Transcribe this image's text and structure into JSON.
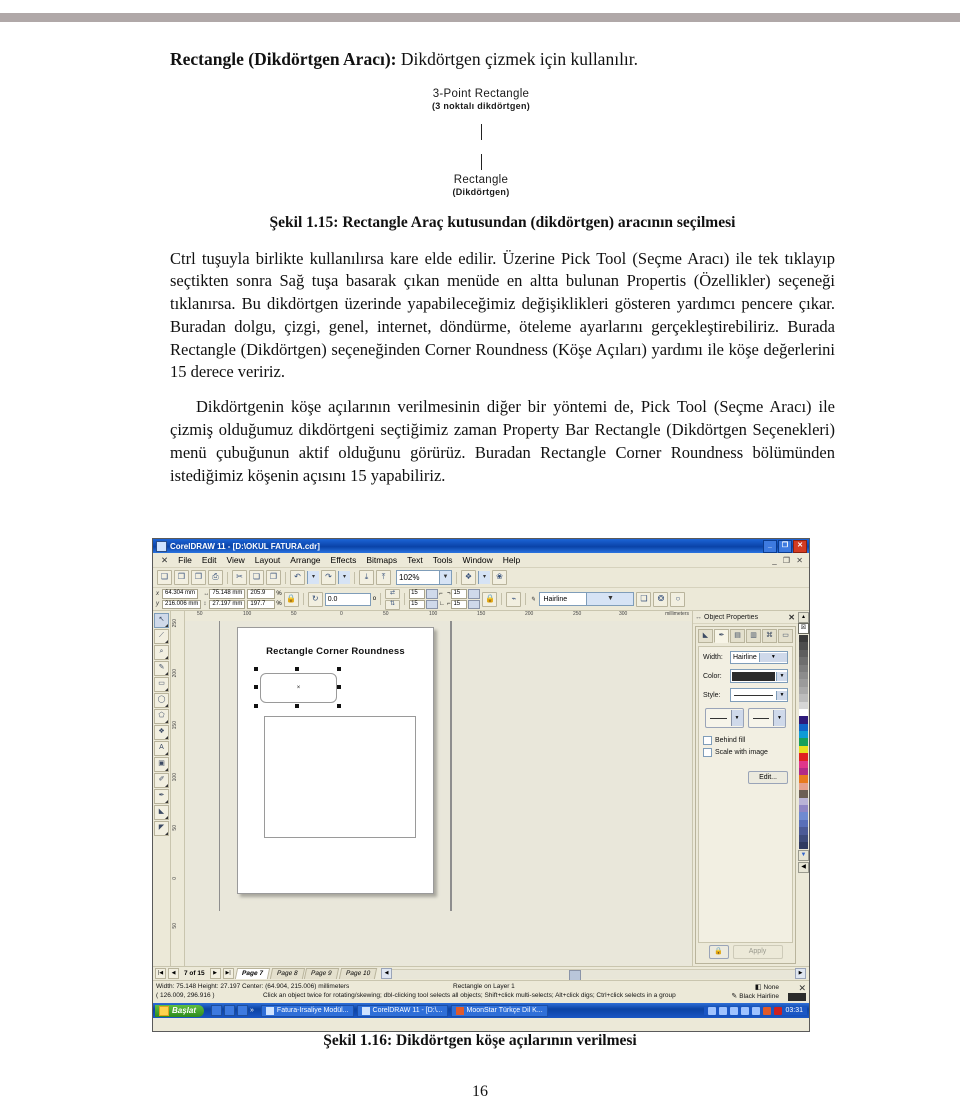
{
  "document": {
    "title_bold": "Rectangle (Dikdörtgen Aracı):",
    "title_rest": " Dikdörtgen çizmek için kullanılır.",
    "figure_1": {
      "label_top_l1": "3-Point Rectangle",
      "label_top_l2": "(3 noktalı dikdörtgen)",
      "label_bottom_l1": "Rectangle",
      "label_bottom_l2": "(Dikdörtgen)"
    },
    "caption_1": "Şekil 1.15: Rectangle Araç kutusundan (dikdörtgen) aracının seçilmesi",
    "paragraph_1": "Ctrl tuşuyla birlikte kullanılırsa kare elde edilir. Üzerine Pick Tool (Seçme Aracı) ile tek tıklayıp seçtikten sonra Sağ tuşa basarak çıkan menüde en altta bulunan Propertis (Özellikler) seçeneği tıklanırsa. Bu dikdörtgen üzerinde yapabileceğimiz değişiklikleri gösteren yardımcı pencere çıkar. Buradan dolgu, çizgi, genel, internet, döndürme, öteleme ayarlarını gerçekleştirebiliriz. Burada Rectangle (Dikdörtgen) seçeneğinden Corner Roundness (Köşe Açıları) yardımı ile köşe değerlerini 15 derece veririz.",
    "paragraph_2": "Dikdörtgenin köşe açılarının verilmesinin diğer bir yöntemi de, Pick Tool (Seçme Aracı) ile çizmiş olduğumuz dikdörtgeni seçtiğimiz zaman Property Bar Rectangle (Dikdörtgen Seçenekleri) menü çubuğunun aktif olduğunu görürüz. Buradan Rectangle Corner Roundness bölümünden istediğimiz köşenin açısını 15 yapabiliriz.",
    "caption_2": "Şekil 1.16: Dikdörtgen köşe açılarının verilmesi",
    "page_number": "16"
  },
  "app": {
    "titlebar": {
      "text": "CorelDRAW 11 - [D:\\OKUL FATURA.cdr]",
      "minimize": "_",
      "restore": "❐",
      "close": "✕"
    },
    "menu": {
      "doc_icon": "✕",
      "items": [
        "File",
        "Edit",
        "View",
        "Layout",
        "Arrange",
        "Effects",
        "Bitmaps",
        "Text",
        "Tools",
        "Window",
        "Help"
      ],
      "doc_buttons": "_ ❐ ✕"
    },
    "toolbar": {
      "buttons": [
        "new-document",
        "open-document",
        "save-document",
        "print-document",
        "cut",
        "copy",
        "paste",
        "undo",
        "redo",
        "import",
        "export"
      ],
      "zoom_value": "102%",
      "zoom_caret": "▼",
      "extra": [
        "application-launcher",
        "corel-online"
      ]
    },
    "property_bar": {
      "x_label": "x",
      "y_label": "y",
      "x_value": "64.304 mm",
      "y_value": "216.006 mm",
      "width_value": "75.148 mm",
      "height_value": "27.197 mm",
      "scale_h": "205.9",
      "scale_v": "197.7",
      "pct_symbol": "%",
      "lock_ratio_icon": "lock",
      "rotation_label": "rotation",
      "rotation_value": "0.0",
      "degree_symbol": "o",
      "mirror_h_icon": "mirror-horizontal",
      "mirror_v_icon": "mirror-vertical",
      "corner_tl": "15",
      "corner_bl": "15",
      "corner_tr": "15",
      "corner_br": "15",
      "round_lock_icon": "round-corners-together",
      "outline_width": "Hairline",
      "outline_caret": "▼",
      "to_curves_icon": "convert-to-curves",
      "wrap_icon": "text-wrap",
      "none_icon": "no-outline"
    },
    "toolbox": [
      {
        "name": "pick-tool",
        "glyph": "↖",
        "selected": true
      },
      {
        "name": "shape-tool",
        "glyph": "➤",
        "selected": false
      },
      {
        "name": "zoom-tool",
        "glyph": "⌕",
        "selected": false
      },
      {
        "name": "freehand-tool",
        "glyph": "✎",
        "selected": false
      },
      {
        "name": "rectangle-tool",
        "glyph": "▭",
        "selected": false
      },
      {
        "name": "ellipse-tool",
        "glyph": "○",
        "selected": false
      },
      {
        "name": "polygon-tool",
        "glyph": "⬠",
        "selected": false
      },
      {
        "name": "basic-shapes-tool",
        "glyph": "❖",
        "selected": false
      },
      {
        "name": "text-tool",
        "glyph": "A",
        "selected": false
      },
      {
        "name": "interactive-blend-tool",
        "glyph": "▣",
        "selected": false
      },
      {
        "name": "eyedropper-tool",
        "glyph": "✐",
        "selected": false
      },
      {
        "name": "outline-tool",
        "glyph": "✒",
        "selected": false
      },
      {
        "name": "fill-tool",
        "glyph": "◢",
        "selected": false
      },
      {
        "name": "interactive-fill-tool",
        "glyph": "◤",
        "selected": false
      }
    ],
    "rulers": {
      "unit": "millimeters",
      "horizontal_ticks": [
        "50",
        "100",
        "50",
        "0",
        "50",
        "100",
        "150",
        "200",
        "250",
        "300"
      ],
      "vertical_ticks": [
        "250",
        "200",
        "150",
        "100",
        "50",
        "0",
        "50"
      ]
    },
    "canvas": {
      "page_heading": "Rectangle Corner Roundness",
      "selected_object_center_mark": "×"
    },
    "docker": {
      "title": "Object Properties",
      "grip_icon": "↔",
      "close_icon": "✕",
      "tabs": [
        {
          "name": "fill-tab",
          "glyph": "◣"
        },
        {
          "name": "outline-tab",
          "glyph": "✐"
        },
        {
          "name": "general-tab",
          "glyph": "▤"
        },
        {
          "name": "detail-tab",
          "glyph": "▥"
        },
        {
          "name": "internet-tab",
          "glyph": "⌘"
        },
        {
          "name": "rectangle-tab",
          "glyph": "▭"
        }
      ],
      "width_label": "Width:",
      "width_value": "Hairline",
      "color_label": "Color:",
      "color_value": "#2b2b2b",
      "style_label": "Style:",
      "checkbox_behind_fill": "Behind fill",
      "checkbox_scale_with_image": "Scale with image",
      "edit_button": "Edit...",
      "lock_button_icon": "lock",
      "apply_button": "Apply",
      "caret": "▼"
    },
    "palette": {
      "top_icon": "palette-scroll-up",
      "none_swatch": "☒",
      "colors": [
        "#3a3a3a",
        "#4d4d4d",
        "#5e5e5e",
        "#6e6e6e",
        "#7d7d7d",
        "#8c8c8c",
        "#9b9b9b",
        "#aaaaaa",
        "#bcbcbc",
        "#d6d6d6",
        "#ffffff",
        "#2e1a7a",
        "#1064c8",
        "#0f9bd7",
        "#17a05a",
        "#e8e01f",
        "#e02020",
        "#e0368a",
        "#b22a86",
        "#e87a1e",
        "#e6a08c",
        "#6b5e55",
        "#b9b3d6",
        "#8f86c4",
        "#6f8ad0",
        "#5a6fb8",
        "#4c5a96",
        "#3d4a7a",
        "#2f3a60"
      ],
      "scroll_down_icon": "▼",
      "expand_icon": "◀"
    },
    "page_strip": {
      "first": "|◀",
      "prev": "◀",
      "counter": "7 of 15",
      "next": "▶",
      "last": "▶|",
      "tabs": [
        {
          "label": "Page 7",
          "active": true
        },
        {
          "label": "Page 8",
          "active": false
        },
        {
          "label": "Page 9",
          "active": false
        },
        {
          "label": "Page 10",
          "active": false
        }
      ],
      "scroll_left": "◀",
      "scroll_right": "▶"
    },
    "status_bar": {
      "line1": "Width: 75.148 Height: 27.197 Center: (64.904, 215.006) millimeters",
      "line1_mid": "Rectangle on Layer 1",
      "line2_coords": "( 126.009, 296.916 )",
      "line2_hint": "Click an object twice for rotating/skewing; dbl-clicking tool selects all objects; Shift+click multi-selects; Alt+click digs; Ctrl+click selects in a group",
      "fill_label": "None",
      "outline_label": "Black  Hairline",
      "fill_icon": "fill-swatch",
      "outline_icon": "outline-pen",
      "no-fill_icon": "✕"
    },
    "taskbar": {
      "start_label": "Başlat",
      "quick_launch": [
        "show-desktop-icon",
        "browser-icon",
        "media-icon",
        "more-icon"
      ],
      "items": [
        {
          "label": "Fatura-İrsaliye Modül...",
          "icon": "app-icon"
        },
        {
          "label": "CorelDRAW 11 - [D:\\...",
          "icon": "coreldraw-icon"
        },
        {
          "label": "MoonStar Türkçe Dil K...",
          "icon": "moonstar-icon"
        }
      ],
      "tray_icons": [
        "network-icon",
        "help-icon",
        "update-icon",
        "volume-icon",
        "messenger-icon",
        "antivirus-icon",
        "kaspersky-icon"
      ],
      "clock": "03:31"
    }
  },
  "colors": {
    "title_blue": "#0a43a8",
    "taskbar_blue": "#0b43a4",
    "chrome": "#ece9d8",
    "start_green": "#2f8a1e",
    "header_rule": "#b0a8a8"
  }
}
